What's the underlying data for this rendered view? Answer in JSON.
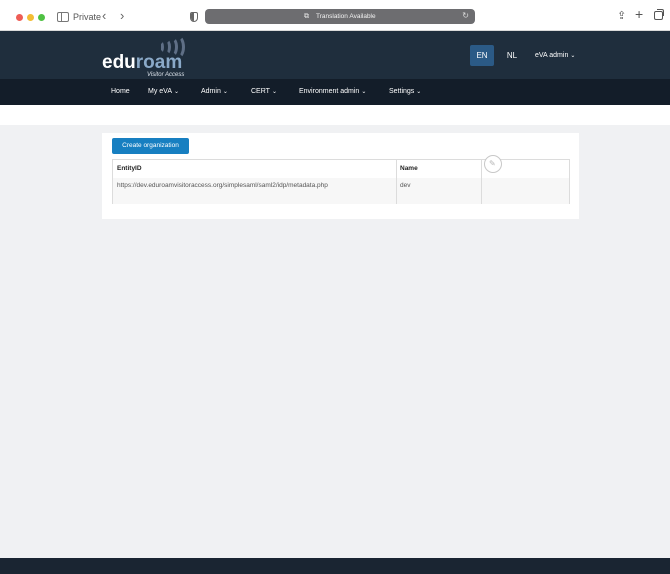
{
  "browser": {
    "private_label": "Private",
    "back_icon": "‹",
    "forward_icon": "›",
    "address_text": "Translation Available",
    "translate_icon": "⧉",
    "reload_icon": "↻",
    "share_icon": "⇪",
    "new_tab_icon": "+"
  },
  "header": {
    "logo_main": "edu",
    "logo_accent": "roam",
    "logo_sub": "Visitor Access",
    "lang_active": "EN",
    "lang_other": "NL",
    "user_label": "eVA admin",
    "chevron": "⌄",
    "accent_color": "#2b5a86"
  },
  "nav": {
    "items": [
      {
        "label": "Home",
        "dropdown": false
      },
      {
        "label": "My eVA",
        "dropdown": true
      },
      {
        "label": "Admin",
        "dropdown": true
      },
      {
        "label": "CERT",
        "dropdown": true
      },
      {
        "label": "Environment admin",
        "dropdown": true
      },
      {
        "label": "Settings",
        "dropdown": true
      }
    ]
  },
  "main": {
    "create_button": "Create organization",
    "table": {
      "headers": [
        "EntityID",
        "Name",
        ""
      ],
      "rows": [
        {
          "entity_id": "https://dev.eduroamvisitoraccess.org/simplesaml/saml2/idp/metadata.php",
          "name": "dev",
          "action_icon": "✎"
        }
      ]
    }
  }
}
